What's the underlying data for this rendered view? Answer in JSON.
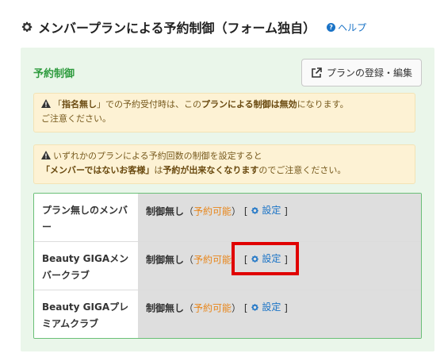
{
  "header": {
    "title": "メンバープランによる予約制御（フォーム独自）",
    "help_label": "ヘルプ",
    "help_icon": "?"
  },
  "panel": {
    "section_label": "予約制御",
    "plan_button_label": "プランの登録・編集"
  },
  "notices": [
    {
      "pre": "「",
      "b1": "指名無し",
      "mid1": "」での予約受付時は、この",
      "b2": "プランによる制御は無効",
      "post": "になります。",
      "line2": "ご注意ください。"
    },
    {
      "line1": "いずれかのプランによる予約回数の制御を設定すると",
      "b1": "「メンバーではないお客様」",
      "mid": "は",
      "b2": "予約が出来なくなります",
      "post": "のでご注意ください。"
    }
  ],
  "rows": [
    {
      "name": "プラン無しのメンバー",
      "status": "制御無し",
      "avail": "予約可能",
      "action": "設定"
    },
    {
      "name": "Beauty GIGAメンバークラブ",
      "status": "制御無し",
      "avail": "予約可能",
      "action": "設定"
    },
    {
      "name": "Beauty GIGAプレミアムクラブ",
      "status": "制御無し",
      "avail": "予約可能",
      "action": "設定"
    }
  ],
  "punct": {
    "open_paren": "（",
    "close_paren": "）",
    "open_bracket": "[",
    "close_bracket": "]"
  },
  "colors": {
    "accent_green": "#2e9b3e",
    "link_blue": "#1a73c6",
    "available_orange": "#e8861b",
    "highlight_red": "#e00000"
  }
}
